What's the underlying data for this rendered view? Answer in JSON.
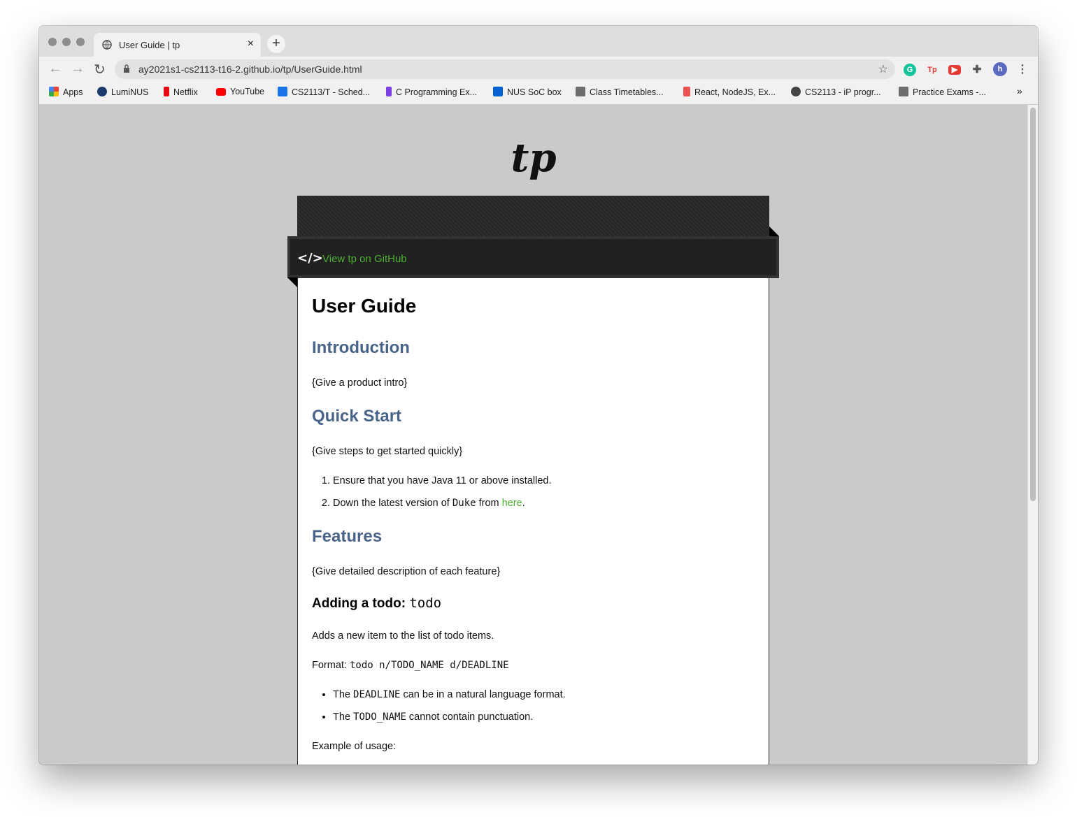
{
  "browser": {
    "tab_title": "User Guide | tp",
    "tab_close": "×",
    "new_tab": "+",
    "url": "ay2021s1-cs2113-t16-2.github.io/tp/UserGuide.html",
    "profile_initial": "h",
    "bookmarks": [
      {
        "label": "Apps",
        "color": "#4285f4"
      },
      {
        "label": "LumiNUS",
        "color": "#1b3a6b"
      },
      {
        "label": "Netflix",
        "color": "#e50914"
      },
      {
        "label": "YouTube",
        "color": "#ff0000"
      },
      {
        "label": "CS2113/T - Sched...",
        "color": "#1a73e8"
      },
      {
        "label": "C Programming Ex...",
        "color": "#7b3fe4"
      },
      {
        "label": "NUS SoC box",
        "color": "#0061d5"
      },
      {
        "label": "Class Timetables...",
        "color": "#6d6d6d"
      },
      {
        "label": "React, NodeJS, Ex...",
        "color": "#ec5252"
      },
      {
        "label": "CS2113 - iP progr...",
        "color": "#444444"
      },
      {
        "label": "Practice Exams -...",
        "color": "#6d6d6d"
      }
    ],
    "overflow": "»"
  },
  "site": {
    "logo": "tp",
    "github_link": "View tp on GitHub",
    "code_icon": "</>"
  },
  "doc": {
    "title": "User Guide",
    "intro_heading": "Introduction",
    "intro_text": "{Give a product intro}",
    "quickstart_heading": "Quick Start",
    "quickstart_text": "{Give steps to get started quickly}",
    "step1": "Ensure that you have Java 11 or above installed.",
    "step2_pre": "Down the latest version of ",
    "step2_code": "Duke",
    "step2_mid": " from ",
    "step2_link": "here",
    "step2_post": ".",
    "features_heading": "Features",
    "features_text": "{Give detailed description of each feature}",
    "todo_heading": "Adding a todo: ",
    "todo_heading_code": "todo",
    "todo_desc": "Adds a new item to the list of todo items.",
    "format_label": "Format: ",
    "format_code": "todo n/TODO_NAME d/DEADLINE",
    "bullet1_pre": "The ",
    "bullet1_code": "DEADLINE",
    "bullet1_post": " can be in a natural language format.",
    "bullet2_pre": "The ",
    "bullet2_code": "TODO_NAME",
    "bullet2_post": " cannot contain punctuation.",
    "example_label": "Example of usage:"
  }
}
